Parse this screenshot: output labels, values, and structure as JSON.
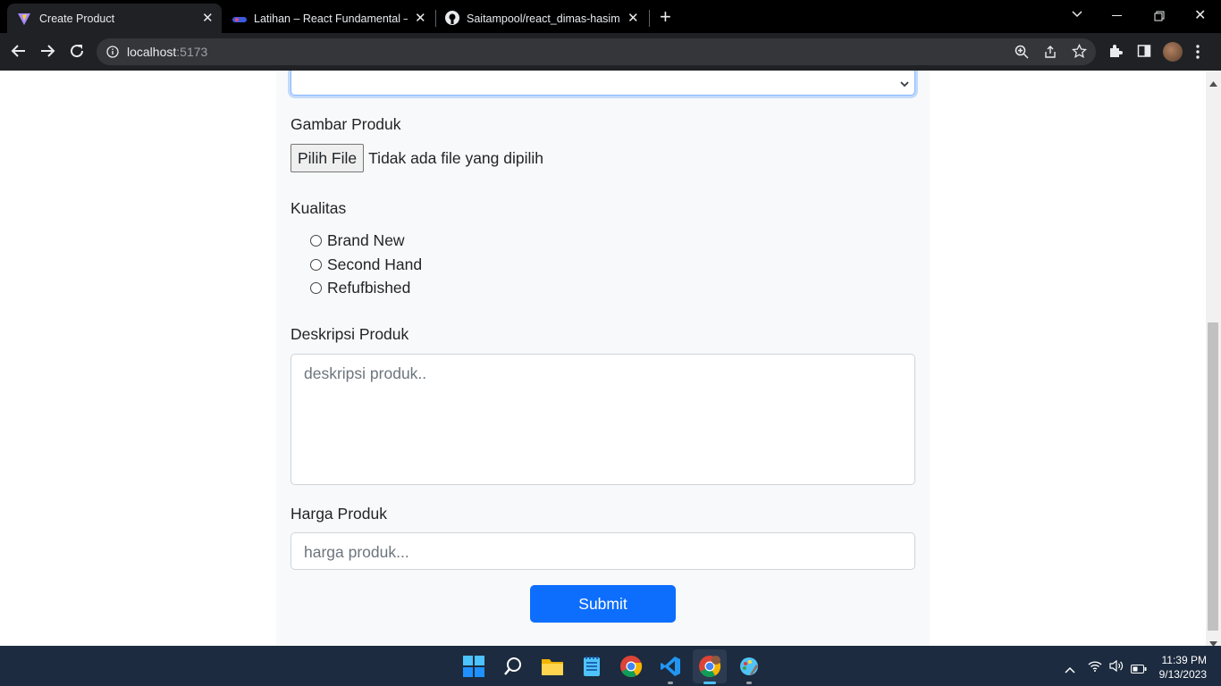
{
  "browser": {
    "tabs": [
      {
        "title": "Create Product",
        "active": true
      },
      {
        "title": "Latihan – React Fundamental – O",
        "active": false
      },
      {
        "title": "Saitampool/react_dimas-hasim-n",
        "active": false
      }
    ],
    "url_host": "localhost",
    "url_port": ":5173"
  },
  "form": {
    "image_label": "Gambar Produk",
    "file_button": "Pilih File",
    "file_status": "Tidak ada file yang dipilih",
    "quality_label": "Kualitas",
    "quality_options": [
      "Brand New",
      "Second Hand",
      "Refufbished"
    ],
    "description_label": "Deskripsi Produk",
    "description_placeholder": "deskripsi produk..",
    "price_label": "Harga Produk",
    "price_placeholder": "harga produk...",
    "submit_label": "Submit"
  },
  "taskbar": {
    "time": "11:39 PM",
    "date": "9/13/2023"
  },
  "colors": {
    "accent": "#0d6efd",
    "chrome_dark": "#202124",
    "taskbar": "#1c2b3f"
  }
}
